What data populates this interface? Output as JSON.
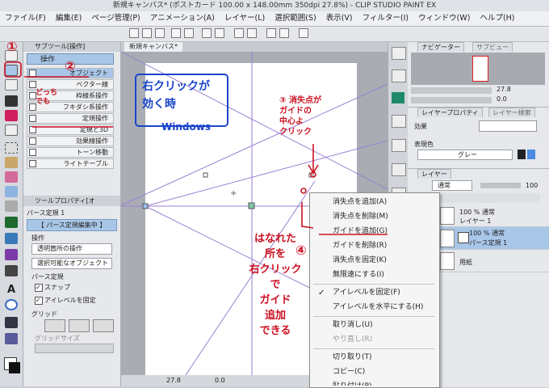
{
  "window": {
    "title": "新規キャンバス* (ポストカード 100.00 x 148.00mm 350dpi 27.8%) - CLIP STUDIO PAINT EX"
  },
  "menu": [
    "ファイル(F)",
    "編集(E)",
    "ページ管理(P)",
    "アニメーション(A)",
    "レイヤー(L)",
    "選択範囲(S)",
    "表示(V)",
    "フィルター(I)",
    "ウィンドウ(W)",
    "ヘルプ(H)"
  ],
  "subtool": {
    "header": "サブツール[操作]",
    "group": "操作",
    "items": [
      "オブジェクト",
      "ベクター線",
      "枠線系操作",
      "フキダシ系操作",
      "定規操作",
      "定規と3D",
      "効果線操作",
      "トーン移動",
      "ライトテーブル"
    ]
  },
  "toolprop": {
    "header": "ツールプロパティ[オ",
    "name": "パース定規 1",
    "edit_button": "【 パース定規編集中 】",
    "section_operation": "操作",
    "dropdown1": "透明箇所の操作",
    "dropdown2": "選択可能なオブジェクト",
    "section_perspective": "パース定規",
    "check_snap": "スナップ",
    "check_eyelevel": "アイレベルを固定",
    "section_grid": "グリッド",
    "grid_size": "グリッドサイズ"
  },
  "canvas": {
    "tab": "新規キャンバス*",
    "zoom": "27.8",
    "angle": "0.0"
  },
  "navigator": {
    "tabs": [
      "ナビゲーター",
      "サブビュー"
    ],
    "zoom": "27.8",
    "angle": "0.0"
  },
  "layerprop": {
    "tabs": [
      "レイヤープロパティ",
      "レイヤー検索"
    ],
    "effect_label": "効果",
    "color_label": "表現色",
    "color_value": "グレー"
  },
  "layers": {
    "tab": "レイヤー",
    "blend": "通常",
    "opacity": "100",
    "rows": [
      {
        "mode": "100 % 通常",
        "name": "レイヤー 1"
      },
      {
        "mode": "100 % 通常",
        "name": "パース定規 1"
      },
      {
        "mode": "",
        "name": "用紙"
      }
    ]
  },
  "context_menu": {
    "items": [
      {
        "label": "消失点を追加(A)",
        "enabled": true
      },
      {
        "label": "消失点を削除(M)",
        "enabled": true
      },
      {
        "label": "ガイドを追加(G)",
        "enabled": true
      },
      {
        "label": "ガイドを削除(R)",
        "enabled": true
      },
      {
        "label": "消失点を固定(K)",
        "enabled": true
      },
      {
        "label": "無限遠にする(I)",
        "enabled": true
      },
      {
        "label": "アイレベルを固定(F)",
        "enabled": true,
        "checked": true
      },
      {
        "label": "アイレベルを水平にする(H)",
        "enabled": true
      },
      {
        "label": "取り消し(U)",
        "enabled": true
      },
      {
        "label": "やり直し(R)",
        "enabled": false
      },
      {
        "label": "切り取り(T)",
        "enabled": true
      },
      {
        "label": "コピー(C)",
        "enabled": true
      },
      {
        "label": "貼り付け(P)",
        "enabled": true
      }
    ]
  },
  "annotations": {
    "box_title": "右クリックが\n効く時",
    "windows": "Windows",
    "num1": "①",
    "num2": "②",
    "side_note": "どっちでも",
    "step3": "③ 消失点が\nガイドの\n中心よ\nクリック",
    "step4": "④",
    "bottom_note": "はなれた\n所を\n右クリック\nで\nガイド\n追加\nできる"
  },
  "colors": {
    "accent": "#a8c7e8",
    "annotation_red": "#cc1122",
    "annotation_blue": "#1a44cc",
    "guide": "#9a7fd1"
  }
}
